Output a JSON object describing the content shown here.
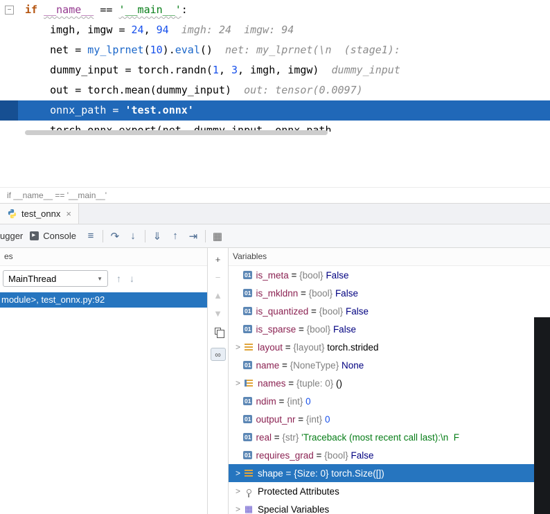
{
  "colors": {
    "selection_blue": "#2675bf",
    "execution_line_blue": "#2068b8",
    "string_green": "#067d17",
    "number_blue": "#1750eb",
    "keyword_orange": "#b4540f",
    "hint_gray": "#8c8c8c",
    "variable_name_maroon": "#8b2252",
    "dark_strip": "#17191c"
  },
  "icons": {
    "close": "×",
    "caret_down": "▼",
    "frame_up": "↑",
    "frame_down": "↓",
    "chevron": ">",
    "primitive_label": "01",
    "grid_glyph": "▦"
  },
  "editor": {
    "breadcrumb": "if __name__ == '__main__'",
    "code_lines": [
      {
        "indent": 0,
        "fold": "−",
        "tokens": [
          {
            "t": "if ",
            "c": "kw"
          },
          {
            "t": "__name__",
            "c": "dunder",
            "u": true
          },
          {
            "t": " == ",
            "c": "plain"
          },
          {
            "t": "'__main__'",
            "c": "str",
            "u": true
          },
          {
            "t": ":",
            "c": "plain"
          }
        ]
      },
      {
        "indent": 1,
        "tokens": [
          {
            "t": "imgh, imgw = ",
            "c": "plain"
          },
          {
            "t": "24",
            "c": "num"
          },
          {
            "t": ", ",
            "c": "plain"
          },
          {
            "t": "94",
            "c": "num"
          },
          {
            "t": "  imgh: 24  imgw: 94",
            "c": "hint"
          }
        ]
      },
      {
        "indent": 1,
        "tokens": [
          {
            "t": "net = ",
            "c": "plain"
          },
          {
            "t": "my_lprnet",
            "c": "call"
          },
          {
            "t": "(",
            "c": "plain"
          },
          {
            "t": "10",
            "c": "num"
          },
          {
            "t": ").",
            "c": "plain"
          },
          {
            "t": "eval",
            "c": "call"
          },
          {
            "t": "()",
            "c": "plain"
          },
          {
            "t": "  net: my_lprnet(\\n  (stage1):",
            "c": "hint"
          }
        ]
      },
      {
        "indent": 1,
        "tokens": [
          {
            "t": "dummy_input = torch.randn(",
            "c": "plain"
          },
          {
            "t": "1",
            "c": "num"
          },
          {
            "t": ", ",
            "c": "plain"
          },
          {
            "t": "3",
            "c": "num"
          },
          {
            "t": ", imgh, imgw)",
            "c": "plain"
          },
          {
            "t": "  dummy_input",
            "c": "hint"
          }
        ]
      },
      {
        "indent": 1,
        "tokens": [
          {
            "t": "out = torch.mean(dummy_input)",
            "c": "plain"
          },
          {
            "t": "  out: tensor(0.0097)",
            "c": "hint"
          }
        ]
      },
      {
        "indent": 1,
        "exec": true,
        "tokens": [
          {
            "t": "onnx_path = ",
            "c": "plain"
          },
          {
            "t": "'test.onnx'",
            "c": "str",
            "b": true
          }
        ]
      },
      {
        "indent": 1,
        "clipped": true,
        "tokens": [
          {
            "t": "torch.onnx.export(net, dummy_input, onnx_path,",
            "c": "plain"
          }
        ]
      }
    ]
  },
  "tab": {
    "label": "test_onnx"
  },
  "toolbar": {
    "debugger_label": "ugger",
    "console_label": "Console",
    "items": [
      {
        "type": "icon",
        "name": "settings-lines",
        "glyph": "≡"
      },
      {
        "type": "sep"
      },
      {
        "type": "icon",
        "name": "step-over",
        "glyph": "↷"
      },
      {
        "type": "icon",
        "name": "step-into",
        "glyph": "↓"
      },
      {
        "type": "sep"
      },
      {
        "type": "icon",
        "name": "force-step-into",
        "glyph": "⇓"
      },
      {
        "type": "icon",
        "name": "step-out",
        "glyph": "↑"
      },
      {
        "type": "icon",
        "name": "run-to-cursor",
        "glyph": "⇥"
      },
      {
        "type": "sep"
      },
      {
        "type": "icon",
        "name": "view-breakpoints",
        "glyph": "▦"
      }
    ]
  },
  "frames": {
    "header": "es",
    "thread": "MainThread",
    "selected_frame": "module>, test_onnx.py:92"
  },
  "variables": {
    "title": "Variables",
    "toolbar": [
      {
        "name": "add-watch",
        "glyph": "+"
      },
      {
        "name": "remove-watch",
        "glyph": "−",
        "disabled": true
      },
      {
        "name": "move-up",
        "glyph": "▲",
        "disabled": true
      },
      {
        "name": "move-down",
        "glyph": "▼",
        "disabled": true
      },
      {
        "name": "copy",
        "css": "copy"
      },
      {
        "name": "show-watches",
        "glyph": "∞",
        "boxed": true
      }
    ],
    "rows": [
      {
        "icon": "primitive",
        "name": "is_meta",
        "type": "{bool}",
        "value": "False",
        "vclass": "kwval"
      },
      {
        "icon": "primitive",
        "name": "is_mkldnn",
        "type": "{bool}",
        "value": "False",
        "vclass": "kwval"
      },
      {
        "icon": "primitive",
        "name": "is_quantized",
        "type": "{bool}",
        "value": "False",
        "vclass": "kwval"
      },
      {
        "icon": "primitive",
        "name": "is_sparse",
        "type": "{bool}",
        "value": "False",
        "vclass": "kwval"
      },
      {
        "icon": "list",
        "name": "layout",
        "type": "{layout}",
        "value": "torch.strided",
        "vclass": "plainval",
        "expandable": true
      },
      {
        "icon": "primitive",
        "name": "name",
        "type": "{NoneType}",
        "value": "None",
        "vclass": "kwval"
      },
      {
        "icon": "numlist",
        "name": "names",
        "type": "{tuple: 0}",
        "value": "()",
        "vclass": "plainval",
        "expandable": true
      },
      {
        "icon": "primitive",
        "name": "ndim",
        "type": "{int}",
        "value": "0",
        "vclass": "numval"
      },
      {
        "icon": "primitive",
        "name": "output_nr",
        "type": "{int}",
        "value": "0",
        "vclass": "numval"
      },
      {
        "icon": "primitive",
        "name": "real",
        "type": "{str}",
        "value": "'Traceback (most recent call last):\\n  F",
        "vclass": "strval"
      },
      {
        "icon": "primitive",
        "name": "requires_grad",
        "type": "{bool}",
        "value": "False",
        "vclass": "kwval"
      },
      {
        "icon": "list",
        "name": "shape",
        "type": "{Size: 0}",
        "value": "torch.Size([])",
        "vclass": "plainval",
        "expandable": true,
        "selected": true
      },
      {
        "icon": "key",
        "label": "Protected Attributes",
        "group": true,
        "expandable": true
      },
      {
        "icon": "grid",
        "label": "Special Variables",
        "group": true,
        "expandable": true
      }
    ]
  }
}
